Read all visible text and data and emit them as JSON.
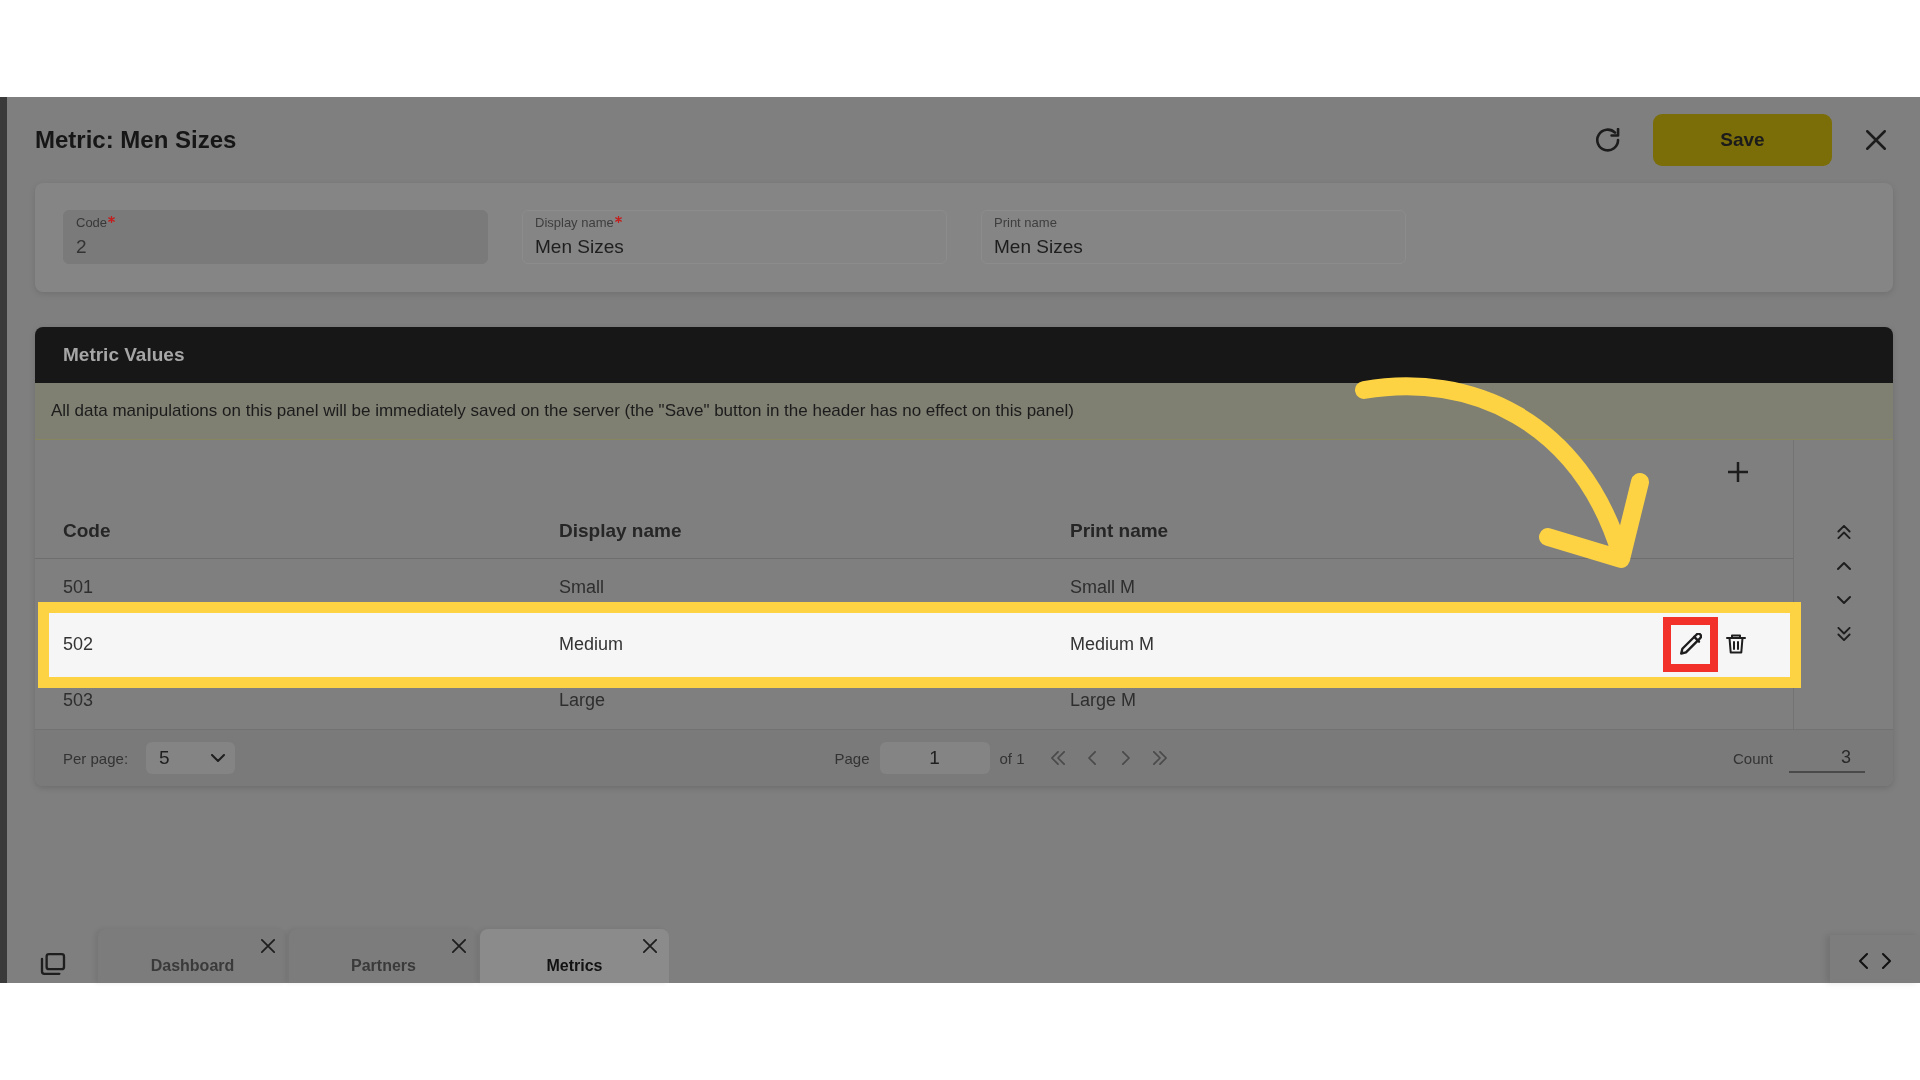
{
  "header": {
    "title": "Metric: Men Sizes",
    "save_label": "Save"
  },
  "form": {
    "fields": [
      {
        "label": "Code",
        "required": true,
        "value": "2",
        "disabled": true
      },
      {
        "label": "Display name",
        "required": true,
        "value": "Men Sizes",
        "disabled": false
      },
      {
        "label": "Print name",
        "required": false,
        "value": "Men Sizes",
        "disabled": false
      }
    ]
  },
  "panel": {
    "title": "Metric Values",
    "notice": "All data manipulations on this panel will be immediately saved on the server (the \"Save\" button in the header has no effect on this panel)"
  },
  "table": {
    "columns": [
      "Code",
      "Display name",
      "Print name"
    ],
    "rows": [
      {
        "cells": [
          "501",
          "Small",
          "Small M"
        ],
        "highlighted": false
      },
      {
        "cells": [
          "502",
          "Medium",
          "Medium M"
        ],
        "highlighted": true
      },
      {
        "cells": [
          "503",
          "Large",
          "Large M"
        ],
        "highlighted": false
      }
    ],
    "row_actions": [
      {
        "kind": "edit",
        "highlighted": true
      },
      {
        "kind": "delete",
        "highlighted": false
      }
    ]
  },
  "pagination": {
    "per_page_label": "Per page:",
    "per_page": "5",
    "page_label": "Page",
    "page": "1",
    "of_label": "of 1",
    "count_label": "Count",
    "count": "3"
  },
  "tabs": [
    {
      "label": "Dashboard",
      "selected": false
    },
    {
      "label": "Partners",
      "selected": false
    },
    {
      "label": "Metrics",
      "selected": true
    }
  ]
}
